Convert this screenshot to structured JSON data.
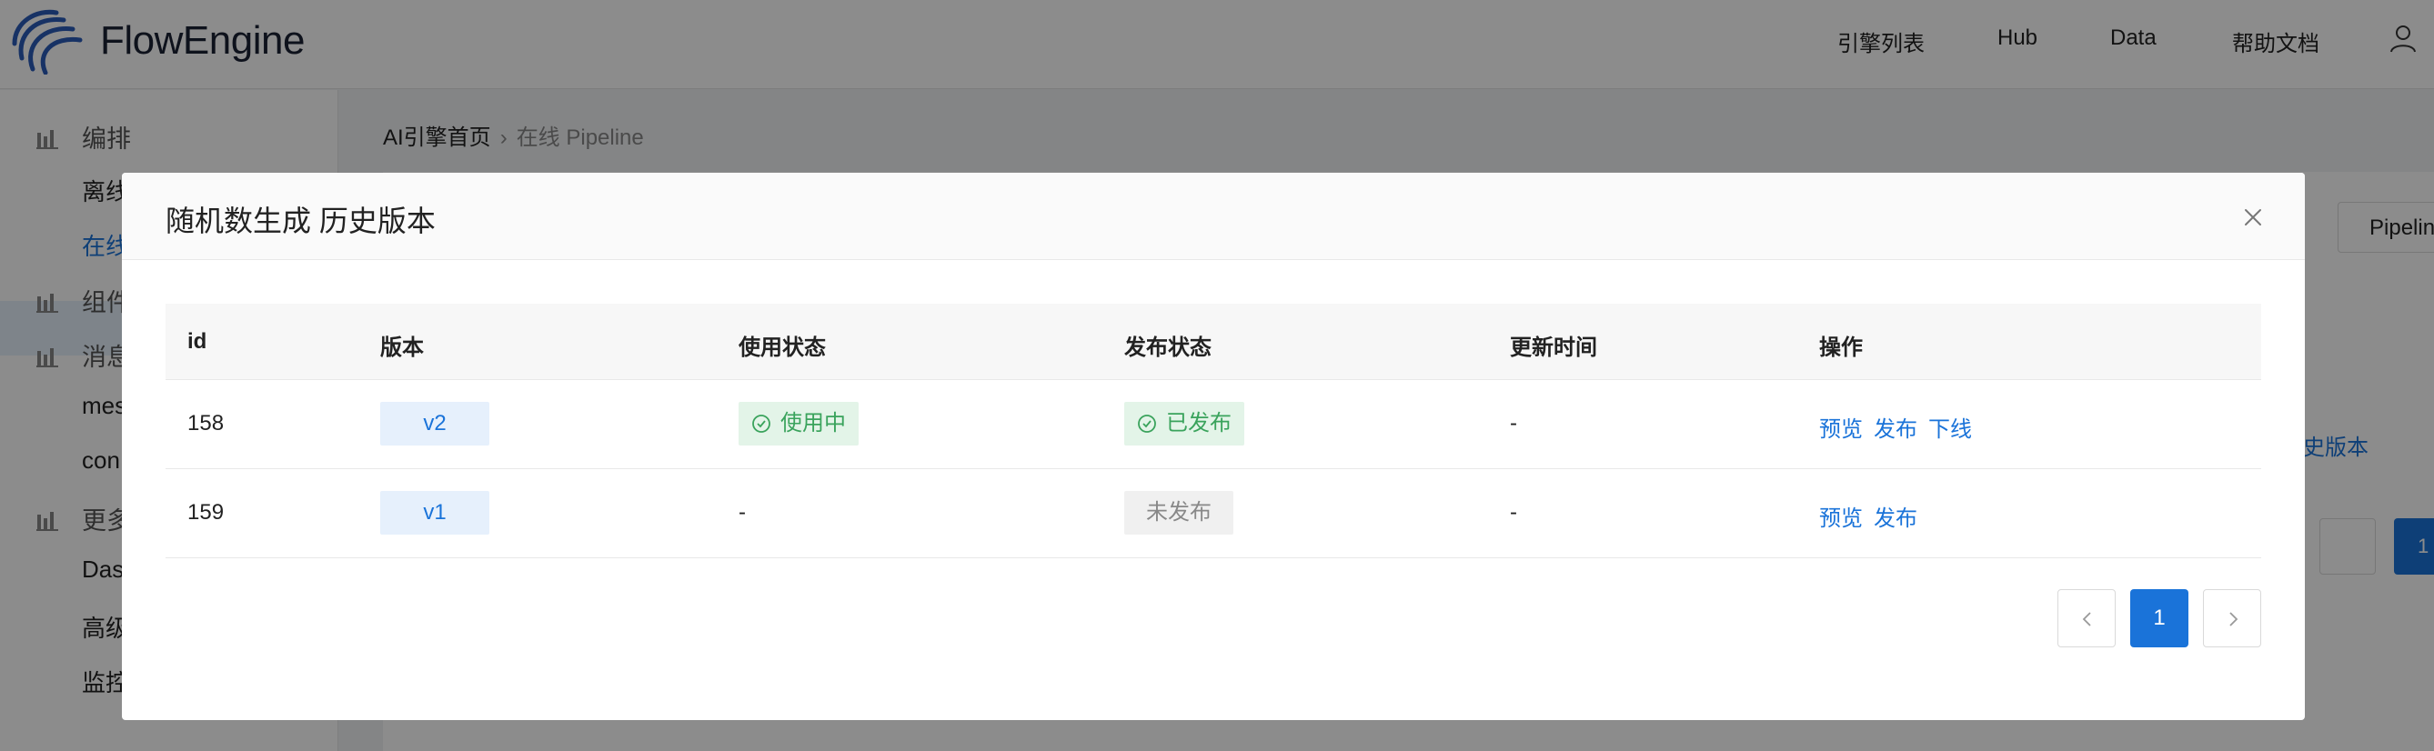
{
  "app": {
    "brand_bold": "Flow",
    "brand_light": "Engine",
    "nav": [
      "引擎列表",
      "Hub",
      "Data",
      "帮助文档"
    ]
  },
  "sidebar": {
    "groups": [
      {
        "label": "编排",
        "icon": "bar-chart-icon"
      },
      {
        "label": "组件",
        "icon": "bar-chart-icon"
      },
      {
        "label": "消息",
        "icon": "bar-chart-icon"
      },
      {
        "label": "更多",
        "icon": "bar-chart-icon"
      }
    ],
    "items": [
      {
        "label": "离线"
      },
      {
        "label": "在线"
      },
      {
        "label": "mes"
      },
      {
        "label": "con"
      },
      {
        "label": "Das"
      },
      {
        "label": "高级"
      },
      {
        "label": "监控"
      }
    ]
  },
  "breadcrumb": {
    "home": "AI引擎首页",
    "current": "在线 Pipeline"
  },
  "background": {
    "button_label": "Pipelin",
    "link_label": "史版本",
    "page_current": "1"
  },
  "modal": {
    "title": "随机数生成 历史版本",
    "columns": [
      "id",
      "版本",
      "使用状态",
      "发布状态",
      "更新时间",
      "操作"
    ],
    "rows": [
      {
        "id": "158",
        "version": "v2",
        "use_status": "使用中",
        "publish_status": "已发布",
        "updated": "-",
        "actions": [
          "预览",
          "发布",
          "下线"
        ]
      },
      {
        "id": "159",
        "version": "v1",
        "use_status": "-",
        "publish_status": "未发布",
        "updated": "-",
        "actions": [
          "预览",
          "发布"
        ]
      }
    ],
    "pagination": {
      "current": "1"
    }
  },
  "colors": {
    "accent": "#1a73d9",
    "success": "#3aa35c",
    "mask": "rgba(0,0,0,0.45)"
  }
}
